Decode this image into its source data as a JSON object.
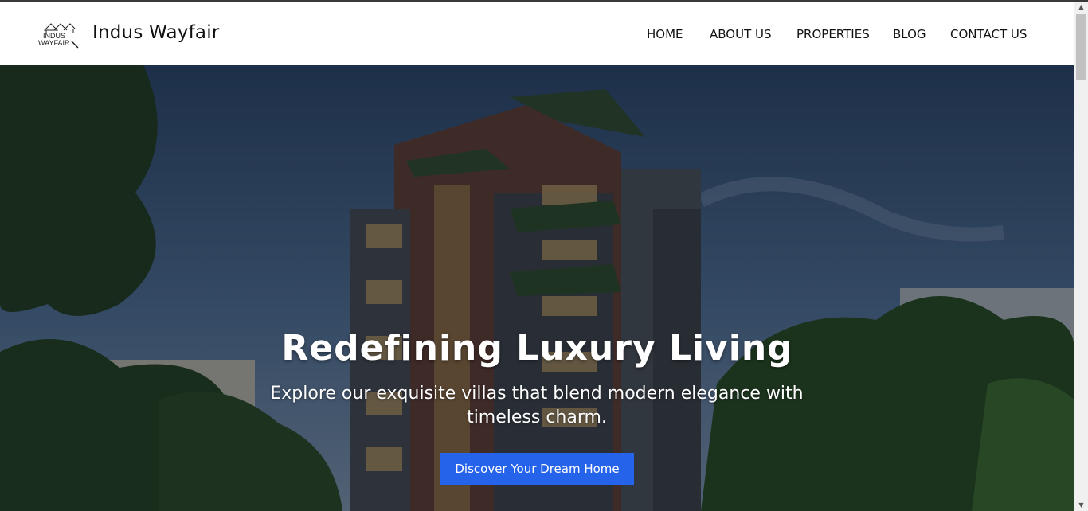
{
  "header": {
    "logo_text_line1": "INDUS",
    "logo_text_line2": "WAYFAIR",
    "brand_name": "Indus Wayfair"
  },
  "nav": {
    "items": [
      "HOME",
      "ABOUT US",
      "PROPERTIES",
      "BLOG",
      "CONTACT US"
    ]
  },
  "hero": {
    "title": "Redefining Luxury Living",
    "subtitle": "Explore our exquisite villas that blend modern elegance with timeless charm.",
    "cta_label": "Discover Your Dream Home",
    "background_image": "apartment-building-with-trees",
    "accent_color": "#2563eb"
  },
  "scrollbar": {
    "icon_up": "scroll-up-arrow-icon",
    "icon_down": "scroll-down-arrow-icon"
  }
}
